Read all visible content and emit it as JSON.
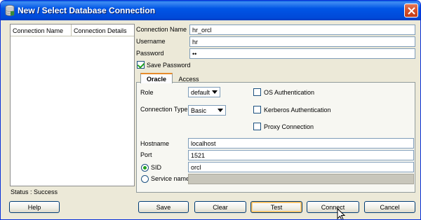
{
  "window": {
    "title": "New / Select Database Connection"
  },
  "connections": {
    "columns": [
      "Connection Name",
      "Connection Details"
    ],
    "rows": []
  },
  "status": "Status : Success",
  "form": {
    "connection_name": {
      "label": "Connection Name",
      "value": "hr_orcl"
    },
    "username": {
      "label": "Username",
      "value": "hr"
    },
    "password": {
      "label": "Password",
      "value": "••"
    },
    "save_password": {
      "label": "Save Password",
      "checked": true
    }
  },
  "tabs": [
    {
      "label": "Oracle",
      "active": true
    },
    {
      "label": "Access",
      "active": false
    }
  ],
  "oracle": {
    "role": {
      "label": "Role",
      "value": "default"
    },
    "connection_type": {
      "label": "Connection Type",
      "value": "Basic"
    },
    "os_auth": {
      "label": "OS Authentication",
      "checked": false
    },
    "kerberos_auth": {
      "label": "Kerberos Authentication",
      "checked": false
    },
    "proxy_connection": {
      "label": "Proxy Connection",
      "checked": false
    },
    "hostname": {
      "label": "Hostname",
      "value": "localhost"
    },
    "port": {
      "label": "Port",
      "value": "1521"
    },
    "sid": {
      "label": "SID",
      "value": "orcl",
      "selected": true
    },
    "service_name": {
      "label": "Service name",
      "value": "",
      "selected": false
    }
  },
  "buttons": {
    "help": "Help",
    "save": "Save",
    "clear": "Clear",
    "test": "Test",
    "connect": "Connect",
    "cancel": "Cancel"
  },
  "colors": {
    "titlebar": "#0055e5",
    "dialog_bg": "#ece9d8",
    "close_button": "#d8532c",
    "tab_accent": "#e68b2c"
  }
}
